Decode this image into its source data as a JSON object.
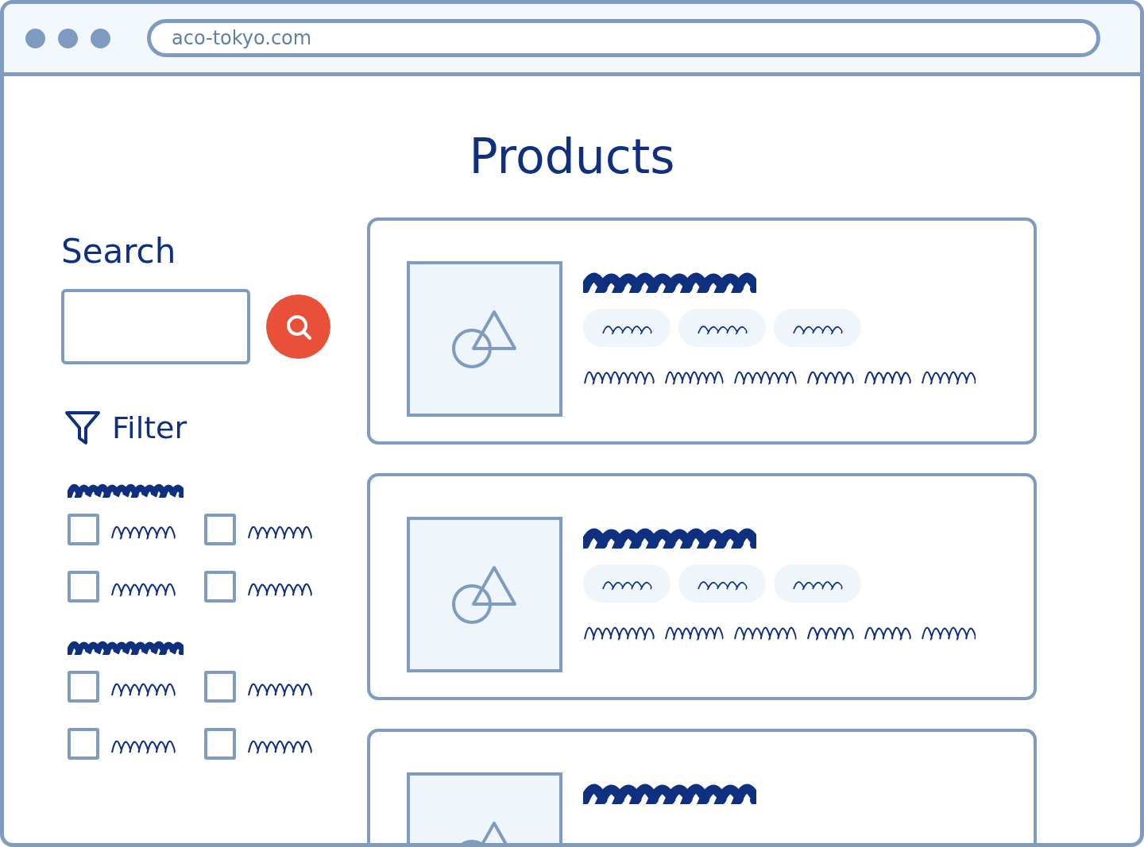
{
  "browser": {
    "url": "aco-tokyo.com"
  },
  "page": {
    "title": "Products"
  },
  "search": {
    "heading": "Search"
  },
  "filter": {
    "heading": "Filter",
    "groups": [
      {
        "options": [
          {
            "checked": false
          },
          {
            "checked": false
          },
          {
            "checked": false
          },
          {
            "checked": false
          }
        ]
      },
      {
        "options": [
          {
            "checked": false
          },
          {
            "checked": false
          },
          {
            "checked": false
          },
          {
            "checked": false
          }
        ]
      }
    ]
  },
  "products": [
    {
      "cut_off": false
    },
    {
      "cut_off": false
    },
    {
      "cut_off": true
    }
  ]
}
